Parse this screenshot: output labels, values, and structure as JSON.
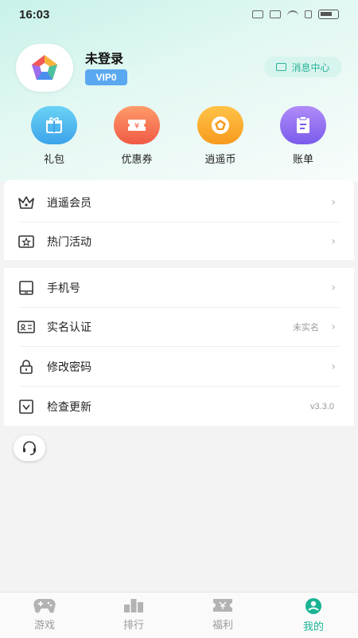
{
  "status_bar": {
    "time": "16:03"
  },
  "profile": {
    "username": "未登录",
    "vip_level": "VIP0",
    "message_center_label": "消息中心"
  },
  "quick_actions": [
    {
      "label": "礼包",
      "icon": "gift-icon",
      "color": "#43b4ec"
    },
    {
      "label": "优惠券",
      "icon": "coupon-icon",
      "color": "#f56a4e"
    },
    {
      "label": "逍遥币",
      "icon": "coin-icon",
      "color": "#f8a22a"
    },
    {
      "label": "账单",
      "icon": "bill-icon",
      "color": "#8b6df0"
    }
  ],
  "menu_group_1": [
    {
      "label": "逍遥会员",
      "icon": "crown-icon"
    },
    {
      "label": "热门活动",
      "icon": "star-box-icon"
    }
  ],
  "menu_group_2": [
    {
      "label": "手机号",
      "icon": "phone-icon"
    },
    {
      "label": "实名认证",
      "icon": "id-card-icon",
      "value": "未实名"
    },
    {
      "label": "修改密码",
      "icon": "lock-icon"
    },
    {
      "label": "检查更新",
      "icon": "update-icon",
      "value": "v3.3.0"
    }
  ],
  "tab_bar": {
    "tabs": [
      {
        "label": "游戏",
        "icon": "gamepad-icon",
        "active": false
      },
      {
        "label": "排行",
        "icon": "ranking-icon",
        "active": false
      },
      {
        "label": "福利",
        "icon": "ticket-icon",
        "active": false
      },
      {
        "label": "我的",
        "icon": "user-icon",
        "active": true
      }
    ],
    "active_color": "#1ab394",
    "inactive_color": "#9a9a9a"
  }
}
